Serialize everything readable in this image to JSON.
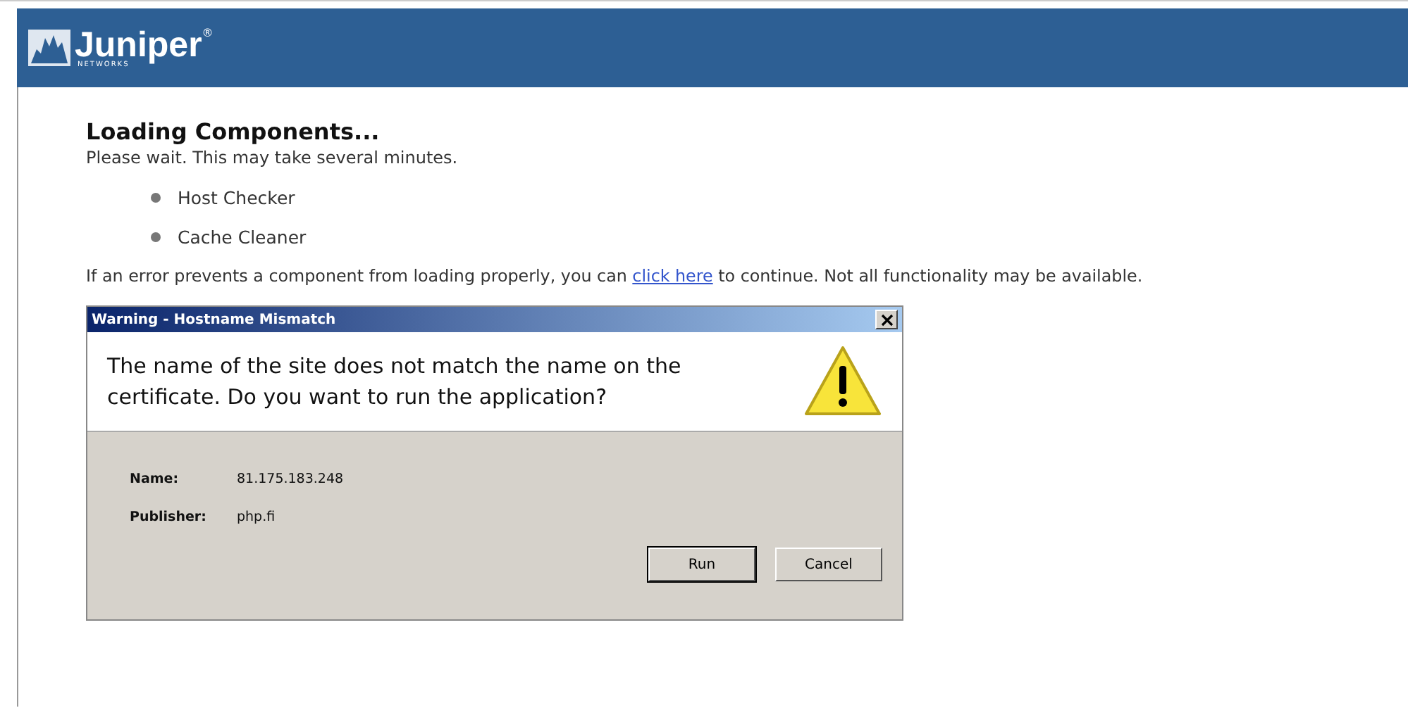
{
  "header": {
    "logo": {
      "name": "Juniper",
      "sub": "NETWORKS",
      "mark": "®"
    }
  },
  "heading": "Loading Components...",
  "subtitle": "Please wait. This may take several minutes.",
  "components": [
    "Host Checker",
    "Cache Cleaner"
  ],
  "error_note": {
    "before": "If an error prevents a component from loading properly, you can ",
    "link": "click here",
    "after": " to continue. Not all functionality may be available."
  },
  "dialog": {
    "title": "Warning - Hostname Mismatch",
    "message": "The name of the site does not match the name on the certificate.  Do you want to run the application?",
    "fields": [
      {
        "label": "Name:",
        "value": "81.175.183.248"
      },
      {
        "label": "Publisher:",
        "value": "php.fi"
      }
    ],
    "buttons": [
      {
        "label": "Run",
        "focused": true
      },
      {
        "label": "Cancel",
        "focused": false
      }
    ]
  }
}
